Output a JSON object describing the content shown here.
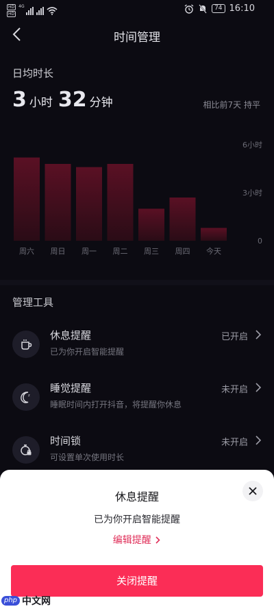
{
  "status_bar": {
    "network_label": "4G",
    "battery": "74",
    "time": "16:10",
    "icons": [
      "hd-icon",
      "signal-icon",
      "wifi-icon",
      "alarm-icon",
      "mute-icon",
      "battery-icon"
    ]
  },
  "header": {
    "title": "时间管理",
    "back_icon": "chevron-left-icon"
  },
  "daily_average": {
    "label": "日均时长",
    "hours": "3",
    "hours_unit": "小时",
    "minutes": "32",
    "minutes_unit": "分钟",
    "comparison": "相比前7天 持平"
  },
  "chart_data": {
    "type": "bar",
    "categories": [
      "周六",
      "周日",
      "周一",
      "周二",
      "周三",
      "周四",
      "今天"
    ],
    "values": [
      5.2,
      4.8,
      4.6,
      4.8,
      2.0,
      2.7,
      0.8
    ],
    "ylim": [
      0,
      6
    ],
    "y_ticks": [
      "6小时",
      "3小时",
      "0"
    ],
    "ylabel": "",
    "xlabel": "",
    "title": "",
    "grid": false,
    "bar_color": "#5a1024",
    "bar_color_dim": "#2a0c16"
  },
  "tools": {
    "section_title": "管理工具",
    "items": [
      {
        "title": "休息提醒",
        "desc": "已为你开启智能提醒",
        "status": "已开启",
        "icon": "coffee-cup-icon"
      },
      {
        "title": "睡觉提醒",
        "desc": "睡眠时间内打开抖音，将提醒你休息",
        "status": "未开启",
        "icon": "moon-icon"
      },
      {
        "title": "时间锁",
        "desc": "可设置单次使用时长",
        "status": "未开启",
        "icon": "timer-lock-icon"
      }
    ]
  },
  "sheet": {
    "title": "休息提醒",
    "desc": "已为你开启智能提醒",
    "edit_link": "编辑提醒",
    "close_button": "关闭提醒",
    "accent": "#fb2d56"
  },
  "watermark": {
    "logo": "php",
    "text": "中文网"
  }
}
